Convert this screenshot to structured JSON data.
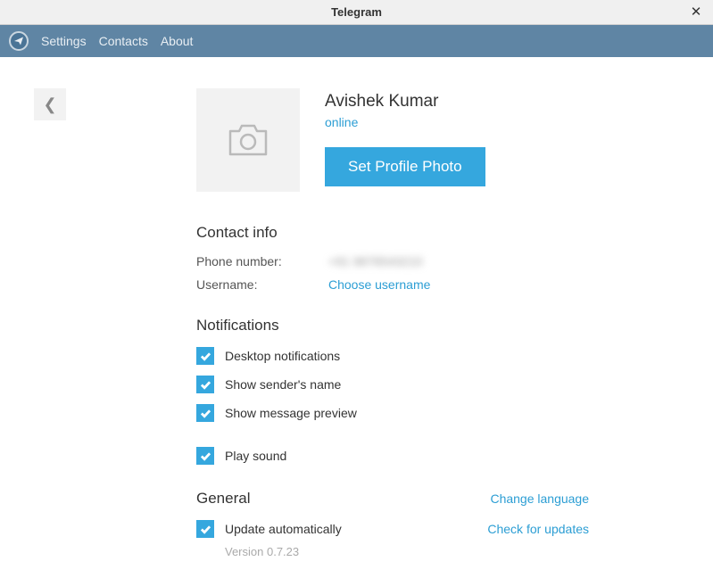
{
  "window": {
    "title": "Telegram"
  },
  "menu": {
    "settings": "Settings",
    "contacts": "Contacts",
    "about": "About"
  },
  "profile": {
    "name": "Avishek Kumar",
    "status": "online",
    "set_photo_label": "Set Profile Photo"
  },
  "contact": {
    "section_title": "Contact info",
    "phone_label": "Phone number:",
    "phone_value": "+91 9876543210",
    "username_label": "Username:",
    "username_value": "Choose username"
  },
  "notifications": {
    "section_title": "Notifications",
    "desktop": "Desktop notifications",
    "sender": "Show sender's name",
    "preview": "Show message preview",
    "sound": "Play sound"
  },
  "general": {
    "section_title": "General",
    "change_language": "Change language",
    "update_auto": "Update automatically",
    "check_updates": "Check for updates",
    "version": "Version 0.7.23"
  }
}
